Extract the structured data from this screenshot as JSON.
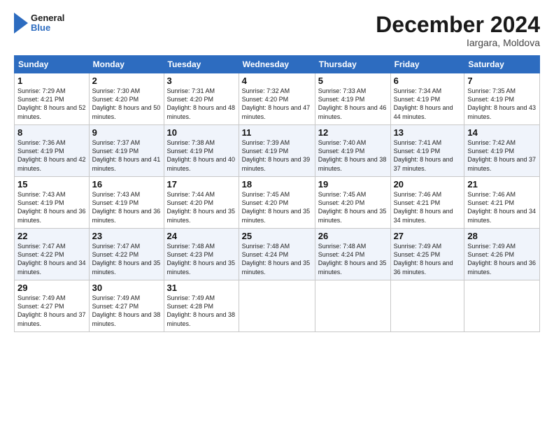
{
  "header": {
    "logo_line1": "General",
    "logo_line2": "Blue",
    "month": "December 2024",
    "location": "Iargara, Moldova"
  },
  "days_of_week": [
    "Sunday",
    "Monday",
    "Tuesday",
    "Wednesday",
    "Thursday",
    "Friday",
    "Saturday"
  ],
  "weeks": [
    [
      {
        "day": "1",
        "sunrise": "7:29 AM",
        "sunset": "4:21 PM",
        "daylight": "8 hours and 52 minutes."
      },
      {
        "day": "2",
        "sunrise": "7:30 AM",
        "sunset": "4:20 PM",
        "daylight": "8 hours and 50 minutes."
      },
      {
        "day": "3",
        "sunrise": "7:31 AM",
        "sunset": "4:20 PM",
        "daylight": "8 hours and 48 minutes."
      },
      {
        "day": "4",
        "sunrise": "7:32 AM",
        "sunset": "4:20 PM",
        "daylight": "8 hours and 47 minutes."
      },
      {
        "day": "5",
        "sunrise": "7:33 AM",
        "sunset": "4:19 PM",
        "daylight": "8 hours and 46 minutes."
      },
      {
        "day": "6",
        "sunrise": "7:34 AM",
        "sunset": "4:19 PM",
        "daylight": "8 hours and 44 minutes."
      },
      {
        "day": "7",
        "sunrise": "7:35 AM",
        "sunset": "4:19 PM",
        "daylight": "8 hours and 43 minutes."
      }
    ],
    [
      {
        "day": "8",
        "sunrise": "7:36 AM",
        "sunset": "4:19 PM",
        "daylight": "8 hours and 42 minutes."
      },
      {
        "day": "9",
        "sunrise": "7:37 AM",
        "sunset": "4:19 PM",
        "daylight": "8 hours and 41 minutes."
      },
      {
        "day": "10",
        "sunrise": "7:38 AM",
        "sunset": "4:19 PM",
        "daylight": "8 hours and 40 minutes."
      },
      {
        "day": "11",
        "sunrise": "7:39 AM",
        "sunset": "4:19 PM",
        "daylight": "8 hours and 39 minutes."
      },
      {
        "day": "12",
        "sunrise": "7:40 AM",
        "sunset": "4:19 PM",
        "daylight": "8 hours and 38 minutes."
      },
      {
        "day": "13",
        "sunrise": "7:41 AM",
        "sunset": "4:19 PM",
        "daylight": "8 hours and 37 minutes."
      },
      {
        "day": "14",
        "sunrise": "7:42 AM",
        "sunset": "4:19 PM",
        "daylight": "8 hours and 37 minutes."
      }
    ],
    [
      {
        "day": "15",
        "sunrise": "7:43 AM",
        "sunset": "4:19 PM",
        "daylight": "8 hours and 36 minutes."
      },
      {
        "day": "16",
        "sunrise": "7:43 AM",
        "sunset": "4:19 PM",
        "daylight": "8 hours and 36 minutes."
      },
      {
        "day": "17",
        "sunrise": "7:44 AM",
        "sunset": "4:20 PM",
        "daylight": "8 hours and 35 minutes."
      },
      {
        "day": "18",
        "sunrise": "7:45 AM",
        "sunset": "4:20 PM",
        "daylight": "8 hours and 35 minutes."
      },
      {
        "day": "19",
        "sunrise": "7:45 AM",
        "sunset": "4:20 PM",
        "daylight": "8 hours and 35 minutes."
      },
      {
        "day": "20",
        "sunrise": "7:46 AM",
        "sunset": "4:21 PM",
        "daylight": "8 hours and 34 minutes."
      },
      {
        "day": "21",
        "sunrise": "7:46 AM",
        "sunset": "4:21 PM",
        "daylight": "8 hours and 34 minutes."
      }
    ],
    [
      {
        "day": "22",
        "sunrise": "7:47 AM",
        "sunset": "4:22 PM",
        "daylight": "8 hours and 34 minutes."
      },
      {
        "day": "23",
        "sunrise": "7:47 AM",
        "sunset": "4:22 PM",
        "daylight": "8 hours and 35 minutes."
      },
      {
        "day": "24",
        "sunrise": "7:48 AM",
        "sunset": "4:23 PM",
        "daylight": "8 hours and 35 minutes."
      },
      {
        "day": "25",
        "sunrise": "7:48 AM",
        "sunset": "4:24 PM",
        "daylight": "8 hours and 35 minutes."
      },
      {
        "day": "26",
        "sunrise": "7:48 AM",
        "sunset": "4:24 PM",
        "daylight": "8 hours and 35 minutes."
      },
      {
        "day": "27",
        "sunrise": "7:49 AM",
        "sunset": "4:25 PM",
        "daylight": "8 hours and 36 minutes."
      },
      {
        "day": "28",
        "sunrise": "7:49 AM",
        "sunset": "4:26 PM",
        "daylight": "8 hours and 36 minutes."
      }
    ],
    [
      {
        "day": "29",
        "sunrise": "7:49 AM",
        "sunset": "4:27 PM",
        "daylight": "8 hours and 37 minutes."
      },
      {
        "day": "30",
        "sunrise": "7:49 AM",
        "sunset": "4:27 PM",
        "daylight": "8 hours and 38 minutes."
      },
      {
        "day": "31",
        "sunrise": "7:49 AM",
        "sunset": "4:28 PM",
        "daylight": "8 hours and 38 minutes."
      },
      null,
      null,
      null,
      null
    ]
  ],
  "labels": {
    "sunrise": "Sunrise:",
    "sunset": "Sunset:",
    "daylight": "Daylight:"
  }
}
